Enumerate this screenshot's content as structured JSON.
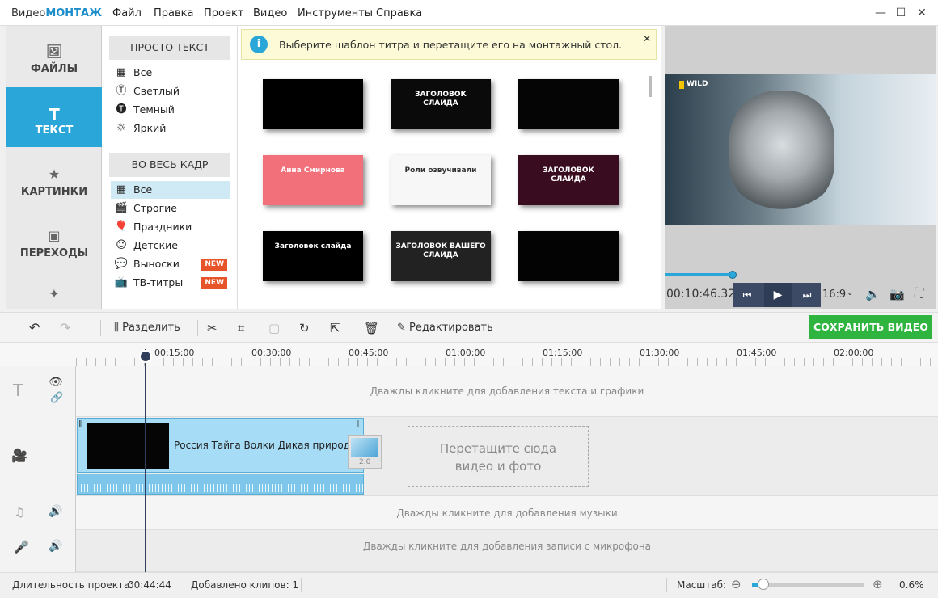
{
  "app": {
    "logo_plain": "Видео",
    "logo_bold": "МОНТАЖ"
  },
  "menu": [
    "Файл",
    "Правка",
    "Проект",
    "Видео",
    "Инструменты",
    "Справка"
  ],
  "window": {
    "minimize": "—",
    "maximize": "☐",
    "close": "✕"
  },
  "nav": [
    {
      "label": "ФАЙЛЫ",
      "icon": "image-icon",
      "glyph": "🖼"
    },
    {
      "label": "ТЕКСТ",
      "icon": "text-icon",
      "glyph": "T"
    },
    {
      "label": "КАРТИНКИ",
      "icon": "star-icon",
      "glyph": "★"
    },
    {
      "label": "ПЕРЕХОДЫ",
      "icon": "transitions-icon",
      "glyph": "▣"
    },
    {
      "label": "",
      "icon": "magic-wand-icon",
      "glyph": "✦"
    }
  ],
  "categories": {
    "section1": "ПРОСТО ТЕКСТ",
    "items1": [
      {
        "label": "Все",
        "glyph": "▦"
      },
      {
        "label": "Светлый",
        "glyph": "Ⓣ"
      },
      {
        "label": "Темный",
        "glyph": "🅣"
      },
      {
        "label": "Яркий",
        "glyph": "☼"
      }
    ],
    "section2": "ВО ВЕСЬ КАДР",
    "items2": [
      {
        "label": "Все",
        "glyph": "▦",
        "selected": true
      },
      {
        "label": "Строгие",
        "glyph": "🎬"
      },
      {
        "label": "Праздники",
        "glyph": "🎈"
      },
      {
        "label": "Детские",
        "glyph": "☺"
      },
      {
        "label": "Выноски",
        "glyph": "💬",
        "badge": "NEW"
      },
      {
        "label": "ТВ-титры",
        "glyph": "📺",
        "badge": "NEW"
      }
    ]
  },
  "info": {
    "text": "Выберите шаблон титра и перетащите его на монтажный стол.",
    "icon": "i",
    "close": "✕"
  },
  "templates": [
    {
      "bg": "#000",
      "text": ""
    },
    {
      "bg": "#0a0a0a",
      "text": "ЗАГОЛОВОК\nСЛАЙДА"
    },
    {
      "bg": "#050505",
      "text": ""
    },
    {
      "bg": "#f2707a",
      "text": "Анна Смирнова"
    },
    {
      "bg": "#f7f7f7",
      "text": "Роли озвучивали"
    },
    {
      "bg": "#3a0c1f",
      "text": "ЗАГОЛОВОК\nСЛАЙДА"
    },
    {
      "bg": "#000",
      "text": "Заголовок слайда"
    },
    {
      "bg": "#222",
      "text": "ЗАГОЛОВОК ВАШЕГО СЛАЙДА"
    },
    {
      "bg": "#030303",
      "text": ""
    }
  ],
  "player": {
    "time": "00:10:46.325",
    "aspect": "16:9",
    "progress": 0.25,
    "watermark": "WILD"
  },
  "toolbar": {
    "split": "Разделить",
    "edit": "Редактировать",
    "save": "СОХРАНИТЬ ВИДЕО"
  },
  "ruler": [
    "00:15:00",
    "00:30:00",
    "00:45:00",
    "01:00:00",
    "01:15:00",
    "01:30:00",
    "01:45:00",
    "02:00:00"
  ],
  "timeline": {
    "text_hint": "Дважды кликните для добавления текста и графики",
    "clip_title": "Россия Тайга Волки Дикая природа I",
    "transition_label": "2.0",
    "drop_hint": "Перетащите сюда видео и фото",
    "music_hint": "Дважды кликните для добавления музыки",
    "mic_hint": "Дважды кликните для добавления записи с микрофона"
  },
  "status": {
    "duration_label": "Длительность проекта:",
    "duration": "00:44:44",
    "clips": "Добавлено клипов: 1",
    "zoom_label": "Масштаб:",
    "zoom": "0.6%",
    "zoom_level": 0.1
  },
  "colors": {
    "accent": "#2aa6d9",
    "save": "#2fb53f",
    "new_badge": "#e8542a"
  }
}
